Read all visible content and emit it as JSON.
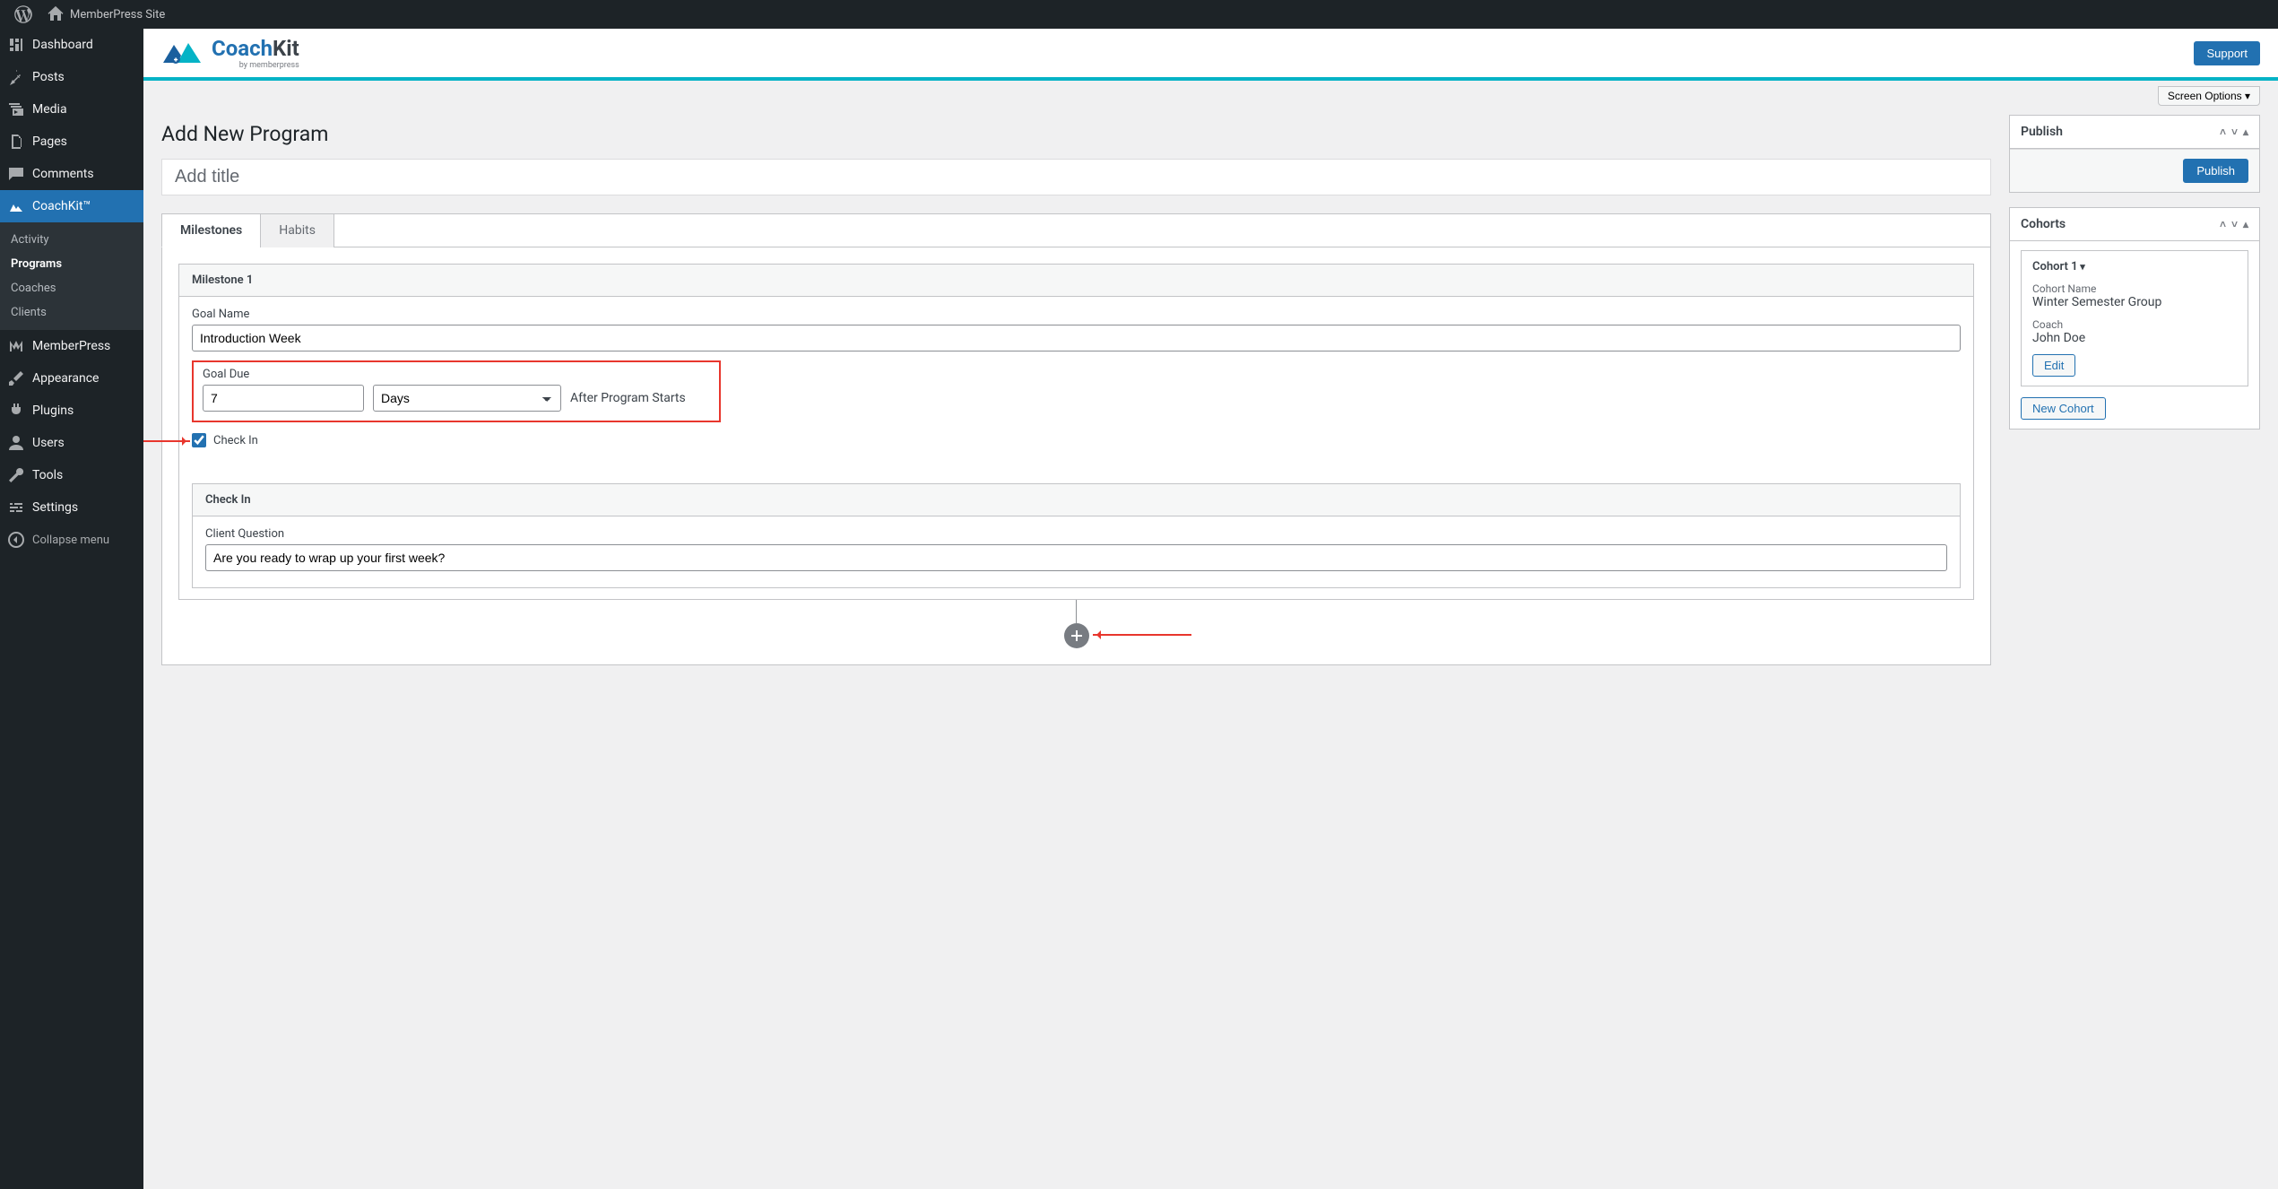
{
  "adminbar": {
    "site_name": "MemberPress Site"
  },
  "sidebar": {
    "items": [
      {
        "label": "Dashboard",
        "icon": "dashboard"
      },
      {
        "label": "Posts",
        "icon": "pin"
      },
      {
        "label": "Media",
        "icon": "media"
      },
      {
        "label": "Pages",
        "icon": "pages"
      },
      {
        "label": "Comments",
        "icon": "comment"
      },
      {
        "label": "CoachKit™",
        "icon": "chart",
        "current": true
      },
      {
        "label": "MemberPress",
        "icon": "m"
      },
      {
        "label": "Appearance",
        "icon": "brush"
      },
      {
        "label": "Plugins",
        "icon": "plug"
      },
      {
        "label": "Users",
        "icon": "user"
      },
      {
        "label": "Tools",
        "icon": "wrench"
      },
      {
        "label": "Settings",
        "icon": "sliders"
      }
    ],
    "coachkit_submenu": [
      "Activity",
      "Programs",
      "Coaches",
      "Clients"
    ],
    "collapse": "Collapse menu"
  },
  "topbar": {
    "logo_main": "CoachKit",
    "logo_sub": "by memberpress",
    "support": "Support"
  },
  "screen_options": "Screen Options  ▾",
  "page_title": "Add New Program",
  "title_placeholder": "Add title",
  "tabs": {
    "milestones": "Milestones",
    "habits": "Habits"
  },
  "milestone": {
    "header": "Milestone 1",
    "goal_name_label": "Goal Name",
    "goal_name_value": "Introduction Week",
    "goal_due_label": "Goal Due",
    "goal_due_number": "7",
    "goal_due_unit": "Days",
    "goal_due_after": "After Program Starts",
    "checkin_label": "Check In"
  },
  "checkin": {
    "header": "Check In",
    "question_label": "Client Question",
    "question_value": "Are you ready to wrap up your first week?"
  },
  "publish_box": {
    "title": "Publish",
    "button": "Publish"
  },
  "cohorts_box": {
    "title": "Cohorts",
    "cohort_header": "Cohort  1",
    "name_label": "Cohort Name",
    "name_value": "Winter Semester Group",
    "coach_label": "Coach",
    "coach_value": "John Doe",
    "edit": "Edit",
    "new_cohort": "New Cohort"
  }
}
